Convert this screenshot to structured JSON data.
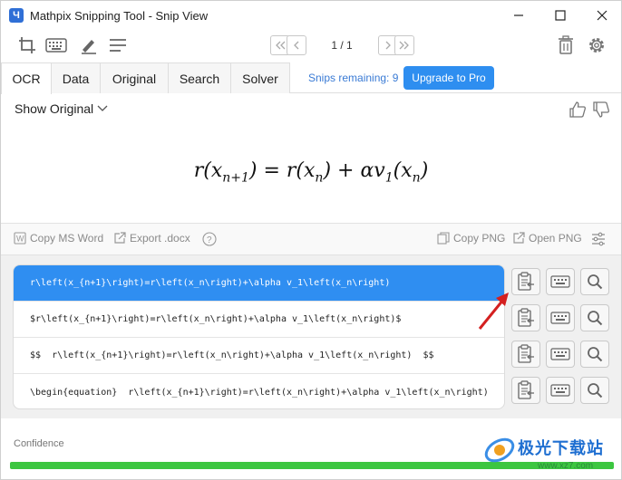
{
  "window": {
    "title": "Mathpix Snipping Tool - Snip View",
    "logo_letter": "Ч"
  },
  "toolbar": {
    "pager": "1 / 1"
  },
  "tabs": [
    {
      "label": "OCR"
    },
    {
      "label": "Data"
    },
    {
      "label": "Original"
    },
    {
      "label": "Search"
    },
    {
      "label": "Solver"
    }
  ],
  "snips_remaining": "Snips remaining: 9",
  "upgrade_label": "Upgrade to Pro",
  "preview": {
    "show_original": "Show Original",
    "formula_lhs": "r(x",
    "formula_lhs_sub": "n+1",
    "formula_mid": ") = r(x",
    "formula_mid_sub": "n",
    "formula_rhs": ") + αv",
    "formula_rhs_sub": "1",
    "formula_tail": "(x",
    "formula_tail_sub": "n",
    "formula_end": ")"
  },
  "actions": {
    "copy_ms_word": "Copy MS Word",
    "export_docx": "Export .docx",
    "copy_png": "Copy PNG",
    "open_png": "Open PNG"
  },
  "results": [
    "r\\left(x_{n+1}\\right)=r\\left(x_n\\right)+\\alpha v_1\\left(x_n\\right)",
    "$r\\left(x_{n+1}\\right)=r\\left(x_n\\right)+\\alpha v_1\\left(x_n\\right)$",
    "$$  r\\left(x_{n+1}\\right)=r\\left(x_n\\right)+\\alpha v_1\\left(x_n\\right)  $$",
    "\\begin{equation}  r\\left(x_{n+1}\\right)=r\\left(x_n\\right)+\\alpha v_1\\left(x_n\\right)"
  ],
  "confidence": {
    "label": "Confidence",
    "value": 1.0
  },
  "watermark": {
    "text": "极光下载站",
    "url": "www.xz7.com"
  },
  "colors": {
    "accent": "#2f8ef1",
    "confidence": "#3cc640"
  }
}
